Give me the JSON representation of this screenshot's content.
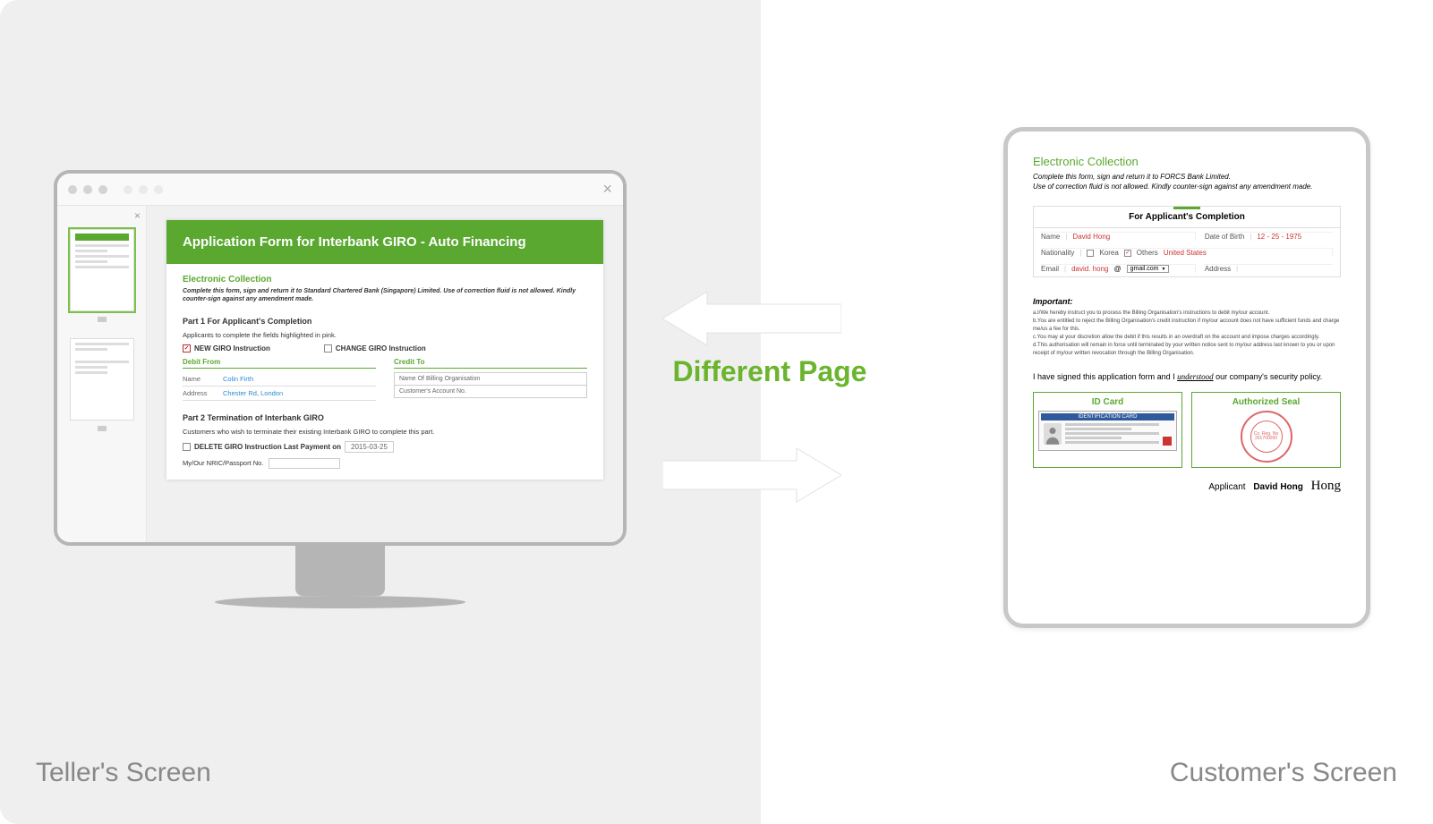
{
  "captions": {
    "left": "Teller's Screen",
    "right": "Customer's Screen"
  },
  "center_label": "Different Page",
  "teller": {
    "doc_title": "Application Form for Interbank GIRO - Auto Financing",
    "ec_title": "Electronic Collection",
    "ec_sub": "Complete this form, sign and return it to Standard Chartered Bank (Singapore) Limited. Use of correction fluid is not allowed. Kindly counter-sign against any amendment made.",
    "part1_title": "Part 1 For Applicant's Completion",
    "part1_hint": "Applicants to complete the fields highlighted in pink.",
    "chk_new": "NEW GIRO Instruction",
    "chk_change": "CHANGE GIRO Instruction",
    "debit_h": "Debit From",
    "credit_h": "Credit To",
    "name_l": "Name",
    "name_v": "Colin Firth",
    "addr_l": "Address",
    "addr_v1": "Chester Rd",
    "addr_v2": "London",
    "credit_r1": "Name Of Billing Organisation",
    "credit_r2": "Customer's Account No.",
    "part2_title": "Part 2 Termination of Interbank GIRO",
    "part2_desc": "Customers who wish to terminate their existing Interbank GIRO to complete this part.",
    "del_label": "DELETE GIRO Instruction Last Payment on",
    "del_date": "2015-03-25",
    "nric_l": "My/Our NRIC/Passport No."
  },
  "customer": {
    "ec_title": "Electronic Collection",
    "ec_sub1": "Complete this form, sign and return it to FORCS Bank Limited.",
    "ec_sub2": "Use of correction fluid is not allowed. Kindly counter-sign against any amendment made.",
    "sec_h": "For Applicant's Completion",
    "name_l": "Name",
    "name_v": "David Hong",
    "dob_l": "Date of Birth",
    "dob_v": "12 - 25 - 1975",
    "nat_l": "Nationality",
    "nat_k": "Korea",
    "nat_o": "Others",
    "nat_v": "United States",
    "email_l": "Email",
    "email_local": "david. hong",
    "email_at": "@",
    "email_dom": "gmail.com",
    "addr_l": "Address",
    "imp_h": "Important:",
    "imp_a": "a.I/We hereby instruct you to process the Billing Organisation's instructions to debit my/our account.",
    "imp_b": "b.You are entitled to reject the Billing Organisation's credit instruction if my/our account does not have sufficient funds and charge me/us a fee for this.",
    "imp_c": "c.You may at your discretion allow the debit if this results in an overdraft on the account and impose charges accordingly.",
    "imp_d": "d.This authorisation will remain in force until terminated by your written notice sent to my/our address last known to you or upon receipt of my/our written revocation through the Billing Organisation.",
    "sign_pre": "I have signed this application form and I ",
    "sign_u": "understood",
    "sign_post": " our company's security policy.",
    "card_id_h": "ID Card",
    "card_id_top": "IDENTIFICATION CARD",
    "card_seal_h": "Authorized Seal",
    "seal_l1": "Co. Reg. No",
    "seal_l2": "201700000",
    "applicant_l": "Applicant",
    "applicant_n": "David Hong",
    "applicant_s": "Hong"
  }
}
